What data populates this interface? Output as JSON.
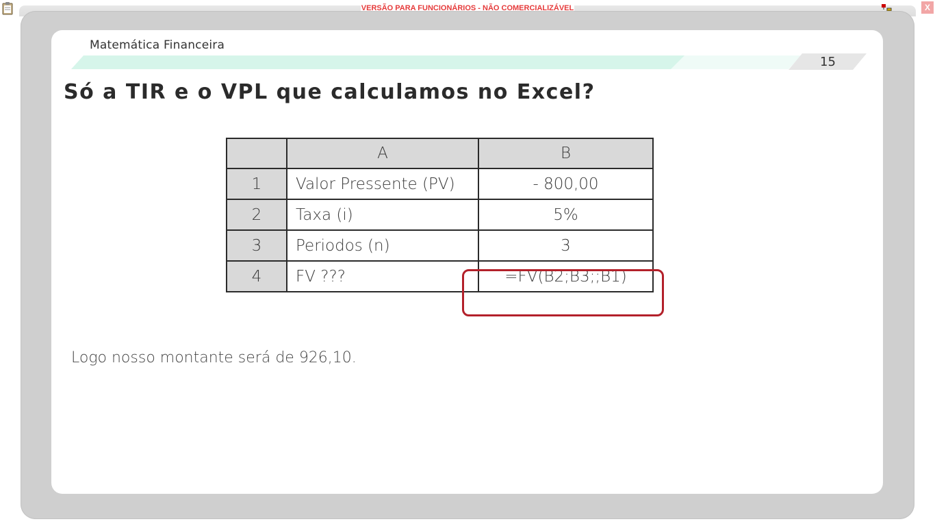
{
  "banner": "VERSÃO PARA FUNCIONÁRIOS - NÃO COMERCIALIZÁVEL",
  "close_label": "X",
  "course": "Matemática Financeira",
  "page_number": "15",
  "title": "Só a TIR e o VPL que calculamos no Excel?",
  "sheet": {
    "col_headers": [
      "",
      "A",
      "B"
    ],
    "rows": [
      {
        "n": "1",
        "a": "Valor Pressente (PV)",
        "b": "- 800,00"
      },
      {
        "n": "2",
        "a": "Taxa (i)",
        "b": "5%"
      },
      {
        "n": "3",
        "a": "Periodos (n)",
        "b": "3"
      },
      {
        "n": "4",
        "a": "FV ???",
        "b": "=FV(B2;B3;;B1)"
      }
    ]
  },
  "conclusion": "Logo nosso montante será de 926,10.",
  "colors": {
    "accent_bar": "#d6f5ea",
    "highlight_border": "#b3202a",
    "banner_text": "#e53a3a"
  }
}
